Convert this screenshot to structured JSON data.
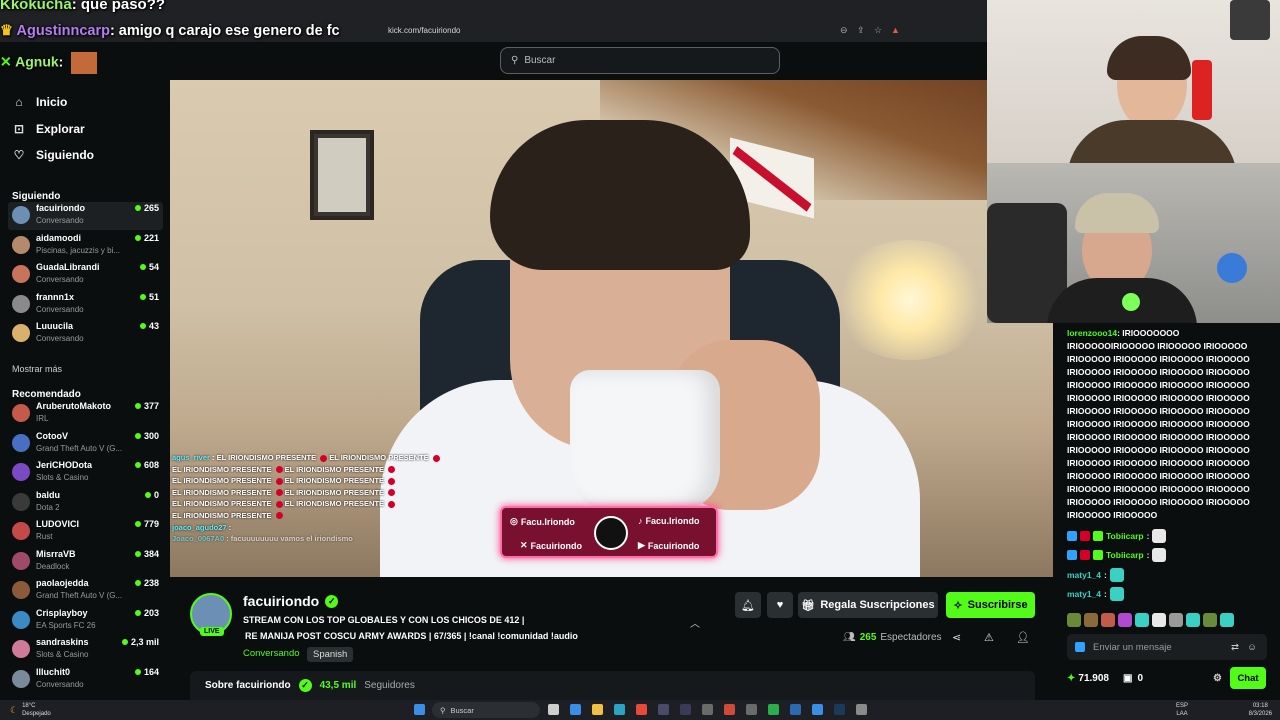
{
  "browser": {
    "url": "kick.com/facuiriondo"
  },
  "overlay_chat": [
    {
      "user": "Kkokucha",
      "message": ": que paso??"
    },
    {
      "user": "Agustinncarp",
      "message": ": amigo q carajo ese genero de fc"
    },
    {
      "user": "Agnuk",
      "message": ":"
    }
  ],
  "header": {
    "search_placeholder": "Buscar"
  },
  "nav": [
    {
      "label": "Inicio",
      "icon": "home-icon"
    },
    {
      "label": "Explorar",
      "icon": "explore-icon"
    },
    {
      "label": "Siguiendo",
      "icon": "heart-icon"
    }
  ],
  "sidebar": {
    "following_title": "Siguiendo",
    "following": [
      {
        "name": "facuiriondo",
        "sub": "Conversando",
        "count": "265",
        "color": "#6c8fb5"
      },
      {
        "name": "aidamoodi",
        "sub": "Piscinas, jacuzzis y bi...",
        "count": "221",
        "color": "#b58a6c"
      },
      {
        "name": "GuadaLibrandi",
        "sub": "Conversando",
        "count": "54",
        "color": "#c9735a"
      },
      {
        "name": "frannn1x",
        "sub": "Conversando",
        "count": "51",
        "color": "#8a8a8a"
      },
      {
        "name": "Luuucila",
        "sub": "Conversando",
        "count": "43",
        "color": "#d9b16c"
      }
    ],
    "show_more": "Mostrar más",
    "recommended_title": "Recomendado",
    "recommended": [
      {
        "name": "AruberutoMakoto",
        "sub": "IRL",
        "count": "377",
        "color": "#c45a4a"
      },
      {
        "name": "CotooV",
        "sub": "Grand Theft Auto V (G...",
        "count": "300",
        "color": "#4a6ec4"
      },
      {
        "name": "JeriCHODota",
        "sub": "Slots & Casino",
        "count": "608",
        "color": "#7a4ac4"
      },
      {
        "name": "baldu",
        "sub": "Dota 2",
        "count": "0",
        "color": "#3a3a3a"
      },
      {
        "name": "LUDOVICI",
        "sub": "Rust",
        "count": "779",
        "color": "#c44a4a"
      },
      {
        "name": "MisrraVB",
        "sub": "Deadlock",
        "count": "384",
        "color": "#a04a6a"
      },
      {
        "name": "paolaojedda",
        "sub": "Grand Theft Auto V (G...",
        "count": "238",
        "color": "#8a5a3a"
      },
      {
        "name": "Crisplayboy",
        "sub": "EA Sports FC 26",
        "count": "203",
        "color": "#3a8ac4"
      },
      {
        "name": "sandraskins",
        "sub": "Slots & Casino",
        "count": "2,3 mil",
        "color": "#d07a9a"
      },
      {
        "name": "Illuchit0",
        "sub": "Conversando",
        "count": "164",
        "color": "#7a8a9a"
      }
    ]
  },
  "video_overlay": {
    "chat_user1": "agus_river",
    "chat_text": "EL IRIONDISMO PRESENTE",
    "chat_user2": "joaco_agudo27",
    "chat_user3": "Joaco_0067A0",
    "chat_text3": "facuuuuuuuu vamos el iriondismo",
    "socials": {
      "instagram": "Facu.Iriondo",
      "tiktok": "Facu.Iriondo",
      "x": "Facuiriondo",
      "youtube": "Facuiriondo"
    }
  },
  "stream": {
    "streamer": "facuiriondo",
    "live_label": "LIVE",
    "title_line1": "STREAM CON LOS TOP GLOBALES Y CON LOS CHICOS DE 412 |",
    "title_line2": "RE MANIJA POST COSCU ARMY AWARDS | 67/365 | !canal !comunidad !audio",
    "category": "Conversando",
    "language": "Spanish",
    "gift_label": "Regala Suscripciones",
    "subscribe_label": "Suscribirse",
    "viewers_count": "265",
    "viewers_label": "Espectadores",
    "about_label": "Sobre facuiriondo",
    "followers": "43,5 mil",
    "followers_label": "Seguidores"
  },
  "chat": {
    "spam_user": "lorenzooo14",
    "spam_text": "IRIOOOOOOO IRIOOOOOIRIOOOOO IRIOOOOO IRIOOOOO IRIOOOOO IRIOOOOO IRIOOOOO IRIOOOOO IRIOOOOO IRIOOOOO IRIOOOOO IRIOOOOO IRIOOOOO IRIOOOOO IRIOOOOO IRIOOOOO IRIOOOOO IRIOOOOO IRIOOOOO IRIOOOOO IRIOOOOO IRIOOOOO IRIOOOOO IRIOOOOO IRIOOOOO IRIOOOOO IRIOOOOO IRIOOOOO IRIOOOOO IRIOOOOO IRIOOOOO IRIOOOOO IRIOOOOO IRIOOOOO IRIOOOOO IRIOOOOO IRIOOOOO IRIOOOOO IRIOOOOO IRIOOOOO IRIOOOOO IRIOOOOO IRIOOOOO IRIOOOOO IRIOOOOO IRIOOOOO IRIOOOOO IRIOOOOO IRIOOOOO IRIOOOOO IRIOOOOO IRIOOOOO IRIOOOOO IRIOOOOO",
    "lines": [
      {
        "user": "Tobiicarp",
        "sep": ":"
      },
      {
        "user": "Tobiicarp",
        "sep": ":"
      },
      {
        "user": "maty1_4",
        "sep": ":"
      },
      {
        "user": "maty1_4",
        "sep": ":"
      }
    ],
    "input_placeholder": "Enviar un mensaje",
    "kicks": "71.908",
    "gifts": "0",
    "chat_button": "Chat"
  },
  "taskbar": {
    "temp": "18°C",
    "weather": "Despejado",
    "search_label": "Buscar",
    "lang1": "ESP",
    "lang2": "LAA",
    "time": "03:18",
    "date": "8/3/2026"
  }
}
